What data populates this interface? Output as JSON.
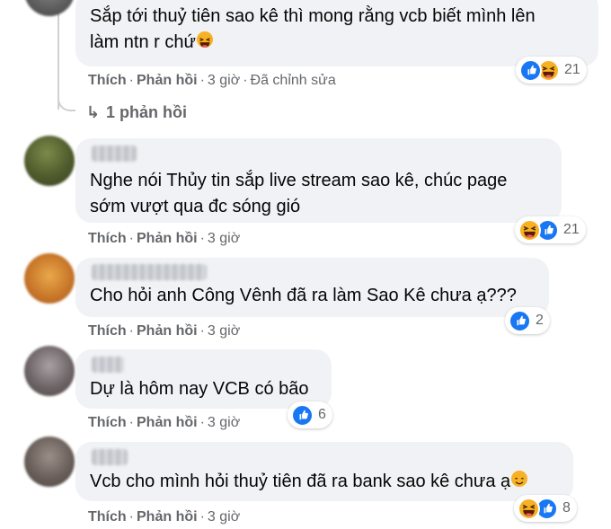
{
  "comments": [
    {
      "text_lines": [
        "Sắp tới thuỷ tiên sao kê thì mong rằng vcb biết mình lên",
        "làm ntn r chứ"
      ],
      "like_label": "Thích",
      "reply_label": "Phản hồi",
      "time": "3 giờ",
      "edited": "Đã chỉnh sửa",
      "reaction_count": "21",
      "reaction_icons": [
        "like-icon",
        "haha-icon"
      ],
      "replies_label": "1 phản hồi"
    },
    {
      "text_lines": [
        "Nghe nói Thủy tin sắp live stream sao kê, chúc page",
        "sớm vượt qua đc sóng gió"
      ],
      "like_label": "Thích",
      "reply_label": "Phản hồi",
      "time": "3 giờ",
      "reaction_count": "21",
      "reaction_icons": [
        "haha-icon",
        "like-icon"
      ]
    },
    {
      "text_lines": [
        "Cho hỏi anh Công Vênh đã ra làm Sao Kê chưa ạ???"
      ],
      "like_label": "Thích",
      "reply_label": "Phản hồi",
      "time": "3 giờ",
      "reaction_count": "2",
      "reaction_icons": [
        "like-icon"
      ]
    },
    {
      "text_lines": [
        "Dự là hôm nay VCB có bão"
      ],
      "like_label": "Thích",
      "reply_label": "Phản hồi",
      "time": "3 giờ",
      "reaction_count": "6",
      "reaction_icons": [
        "like-icon"
      ]
    },
    {
      "text_lines": [
        "Vcb cho mình hỏi thuỷ tiên đã ra bank sao kê chưa ạ"
      ],
      "like_label": "Thích",
      "reply_label": "Phản hồi",
      "time": "3 giờ",
      "reaction_count": "8",
      "reaction_icons": [
        "haha-icon",
        "like-icon"
      ]
    }
  ],
  "colors": {
    "bubble": "#f0f2f5",
    "meta_text": "#65676b",
    "like_blue": "#1877f2",
    "haha_yellow": "#f7b125"
  }
}
